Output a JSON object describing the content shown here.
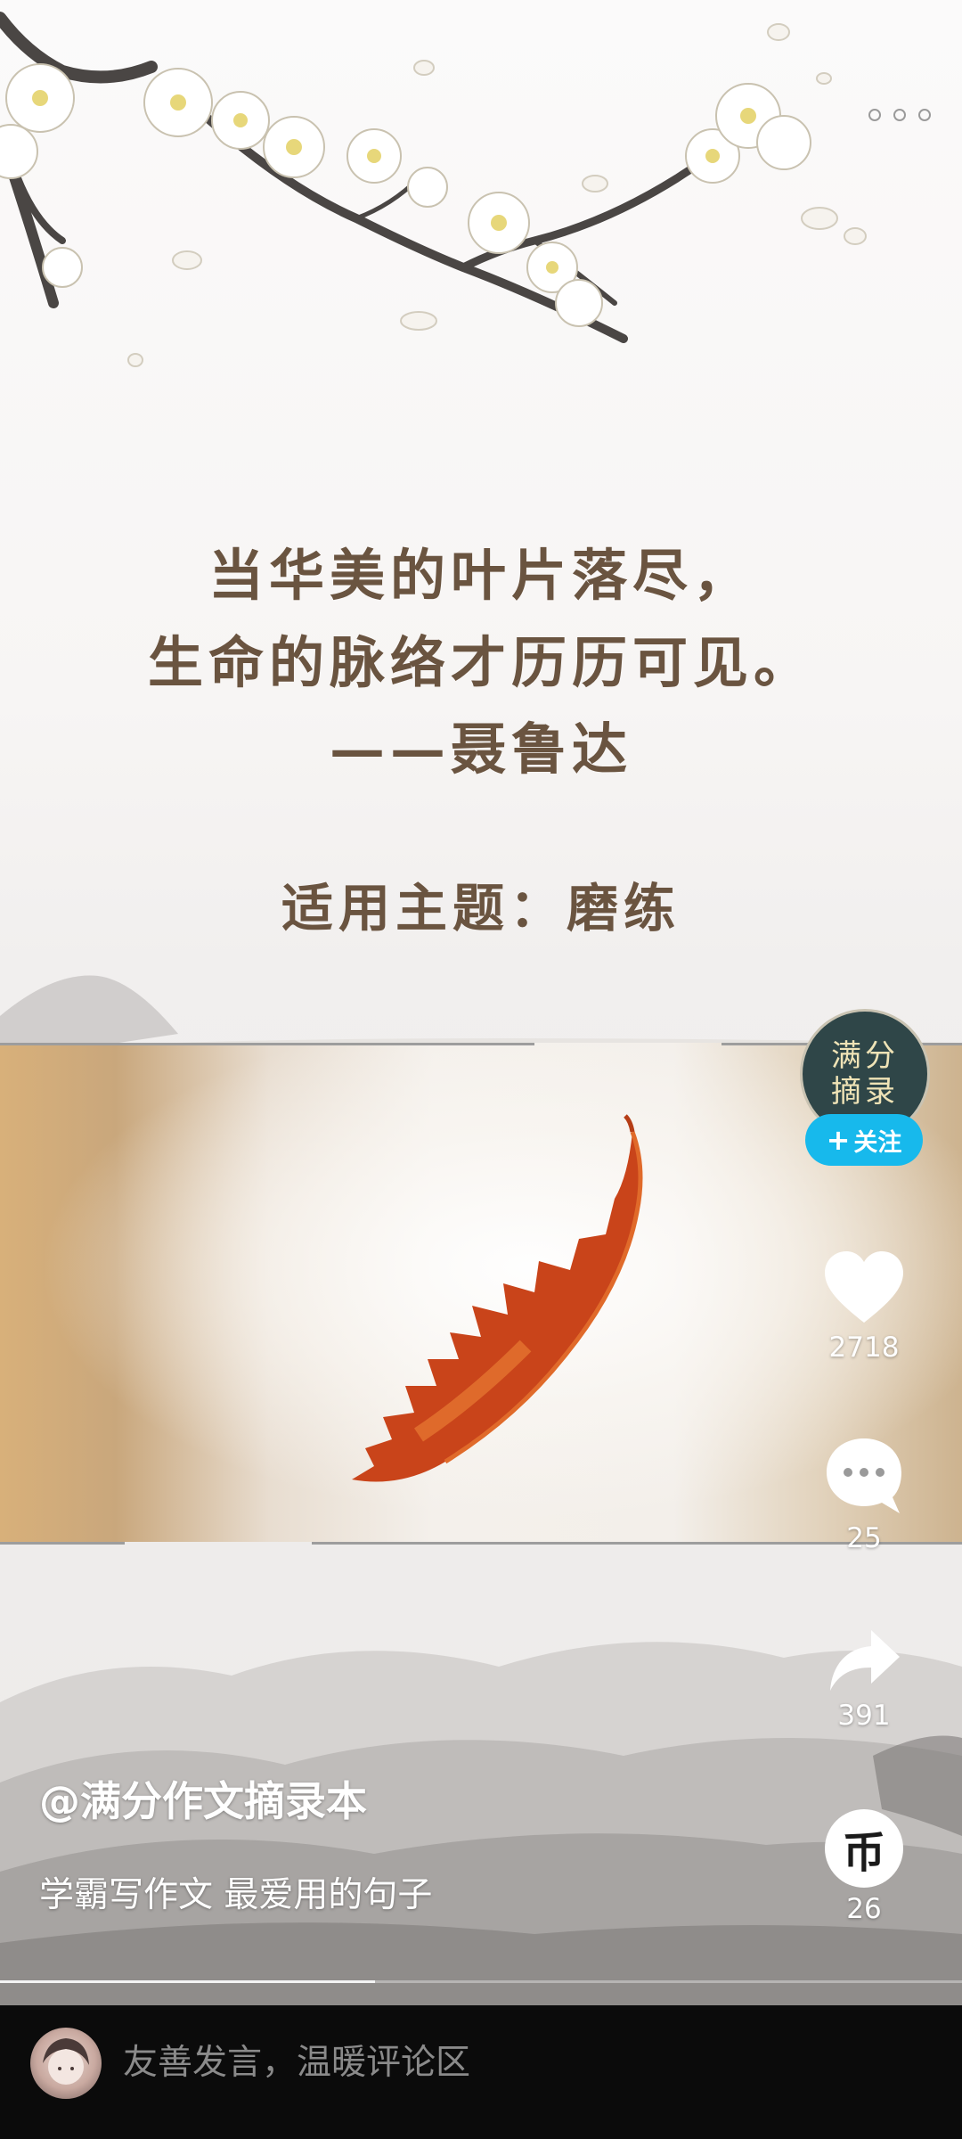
{
  "video": {
    "quote_lines": [
      "当华美的叶片落尽，",
      "生命的脉络才历历可见。",
      "——聂鲁达"
    ],
    "theme_line": "适用主题：磨练",
    "progress": 0.39
  },
  "author": {
    "avatar_text_line1": "满分",
    "avatar_text_line2": "摘录",
    "follow_label": "关注",
    "follow_plus": "+",
    "name": "@满分作文摘录本",
    "caption": "学霸写作文 最爱用的句子"
  },
  "actions": {
    "likes": "2718",
    "comments": "25",
    "shares": "391",
    "coins": "26",
    "coin_glyph": "币"
  },
  "comment_bar": {
    "placeholder": "友善发言，温暖评论区"
  },
  "icons": {
    "more": "more-dots-icon",
    "like": "heart-icon",
    "comment": "comment-bubble-icon",
    "share": "share-arrow-icon",
    "coin": "coin-icon"
  },
  "colors": {
    "follow_accent": "#17b9ec",
    "bottom_bar": "#0b0b0b"
  }
}
